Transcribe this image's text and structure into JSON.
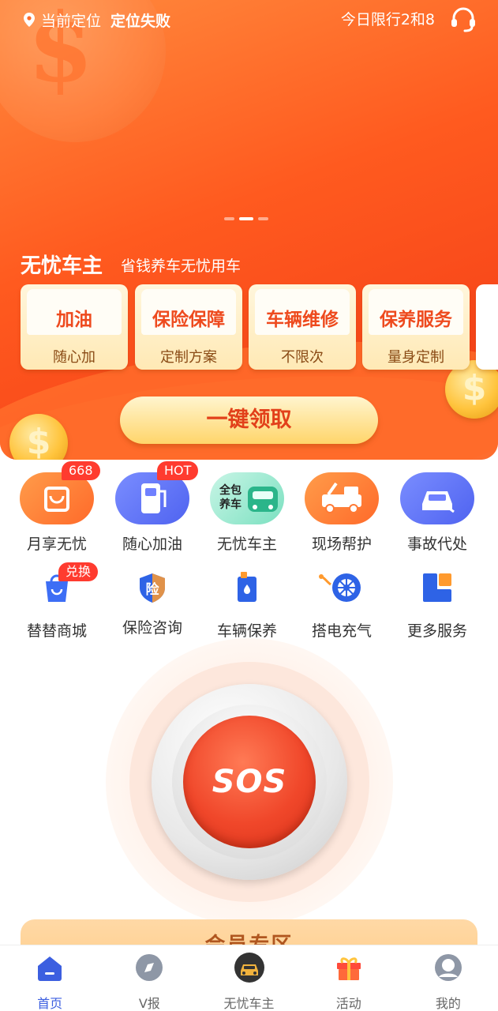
{
  "header": {
    "location_label": "当前定位",
    "location_status": "定位失败",
    "traffic_limit": "今日限行2和8"
  },
  "promo": {
    "title": "无忧车主",
    "subtitle": "省钱养车无忧用车",
    "cards": [
      {
        "title": "加油",
        "subtitle": "随心加"
      },
      {
        "title": "保险保障",
        "subtitle": "定制方案"
      },
      {
        "title": "车辆维修",
        "subtitle": "不限次"
      },
      {
        "title": "保养服务",
        "subtitle": "量身定制"
      }
    ],
    "claim_button": "一键领取",
    "coin_symbol": "$"
  },
  "services_row1": [
    {
      "label": "月享无忧",
      "badge": "668",
      "icon": "bag-icon"
    },
    {
      "label": "随心加油",
      "badge": "HOT",
      "icon": "fuel-pump-icon"
    },
    {
      "label": "无忧车主",
      "icon_text_1": "全包",
      "icon_text_2": "养车",
      "icon": "car-package-icon"
    },
    {
      "label": "现场帮护",
      "icon": "tow-truck-icon"
    },
    {
      "label": "事故代处",
      "icon": "accident-car-icon"
    }
  ],
  "services_row2": [
    {
      "label": "替替商城",
      "badge": "兑换",
      "icon": "shopping-bag-icon"
    },
    {
      "label": "保险咨询",
      "icon_text": "险",
      "icon": "insurance-shield-icon"
    },
    {
      "label": "车辆保养",
      "icon": "oil-can-icon"
    },
    {
      "label": "搭电充气",
      "icon": "tire-pump-icon"
    },
    {
      "label": "更多服务",
      "icon": "more-grid-icon"
    }
  ],
  "sos": {
    "label": "SOS"
  },
  "member": {
    "title": "会员专区"
  },
  "tabbar": [
    {
      "label": "首页",
      "icon": "home-icon",
      "active": true
    },
    {
      "label": "V报",
      "icon": "compass-icon"
    },
    {
      "label": "无忧车主",
      "icon": "car-circle-icon"
    },
    {
      "label": "活动",
      "icon": "gift-icon"
    },
    {
      "label": "我的",
      "icon": "user-icon"
    }
  ],
  "colors": {
    "brand": "#ff5a1f",
    "accent_blue": "#3c5fe0",
    "sos_red": "#f0472a"
  }
}
